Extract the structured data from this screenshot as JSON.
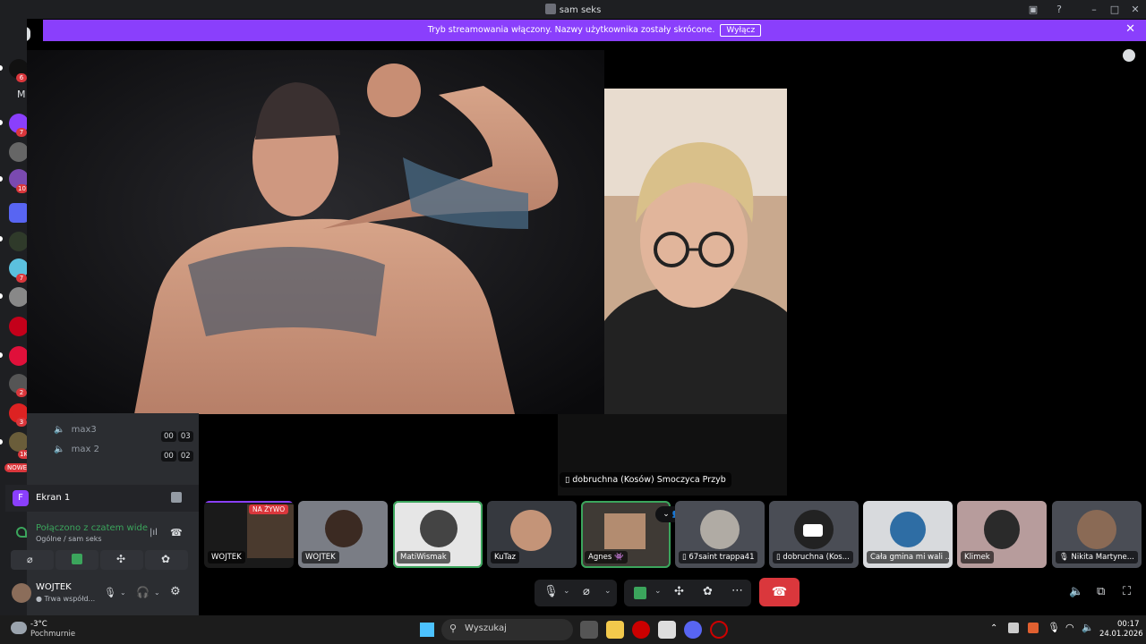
{
  "window": {
    "title": "sam seks"
  },
  "banner": {
    "message": "Tryb streamowania włączony. Nazwy użytkownika zostały skrócone.",
    "button": "Wyłącz"
  },
  "rail": {
    "badges": [
      "6",
      "7",
      "10",
      "7",
      "2",
      "3",
      "1K+"
    ],
    "new_label": "NOWE",
    "folder_letter": "M"
  },
  "voice_channel": {
    "users": [
      {
        "name": "max3",
        "timer_a": "00",
        "timer_b": "03"
      },
      {
        "name": "max 2",
        "timer_a": "00",
        "timer_b": "02"
      }
    ]
  },
  "screen_share": {
    "avatar_letter": "F",
    "label": "Ekran 1"
  },
  "connection": {
    "status": "Połączono z czatem wide",
    "channel": "Ogólne / sam seks"
  },
  "user": {
    "name": "WOJTEK",
    "status": "Trwa współd..."
  },
  "stage": {
    "secondary_label": "dobruchna (Kosów) Smoczyca Przyb"
  },
  "participants": [
    {
      "name": "WOJTEK",
      "live": "NA ŻYWO",
      "has_screen": true
    },
    {
      "name": "WOJTEK"
    },
    {
      "name": "MatiWismak"
    },
    {
      "name": "KuTaz"
    },
    {
      "name": "Agnes 👾"
    },
    {
      "name": "67saint trappa41"
    },
    {
      "name": "dobruchna (Kos..."
    },
    {
      "name": "Cała gmina mi wali ..."
    },
    {
      "name": "Klimek"
    },
    {
      "name": "Nikita Martyne..."
    }
  ],
  "taskbar": {
    "weather_temp": "-3°C",
    "weather_desc": "Pochmurnie",
    "search_placeholder": "Wyszukaj",
    "time": "00:17",
    "date": "24.01.2026"
  },
  "colors": {
    "accent": "#8a3ffc",
    "danger": "#da373c",
    "speaking": "#3ba55c"
  }
}
